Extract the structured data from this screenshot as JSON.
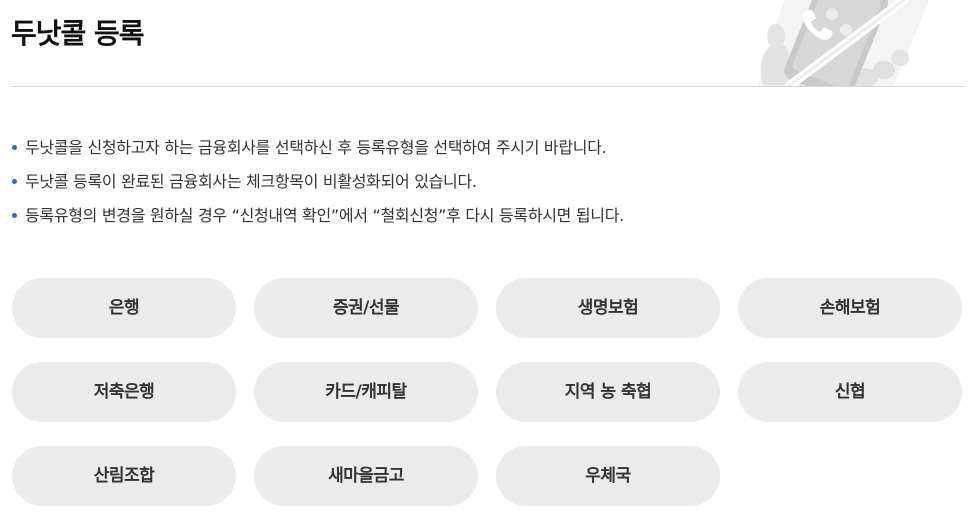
{
  "page": {
    "title": "두낫콜 등록"
  },
  "notices": [
    "두낫콜을 신청하고자 하는 금융회사를 선택하신 후 등록유형을 선택하여 주시기 바랍니다.",
    "두낫콜 등록이 완료된 금융회사는 체크항목이 비활성화되어 있습니다.",
    "등록유형의 변경을 원하실 경우 “신청내역 확인”에서 “철회신청”후 다시 등록하시면 됩니다."
  ],
  "institutions": [
    "은행",
    "증권/선물",
    "생명보험",
    "손해보험",
    "저축은행",
    "카드/캐피탈",
    "지역 농 축협",
    "신협",
    "산림조합",
    "새마을금고",
    "우체국"
  ],
  "colors": {
    "bullet": "#1a73c8",
    "button_bg": "#ebebeb",
    "divider": "#d9d9d9"
  },
  "icons": {
    "hero": "phone-blocked-illustration"
  }
}
